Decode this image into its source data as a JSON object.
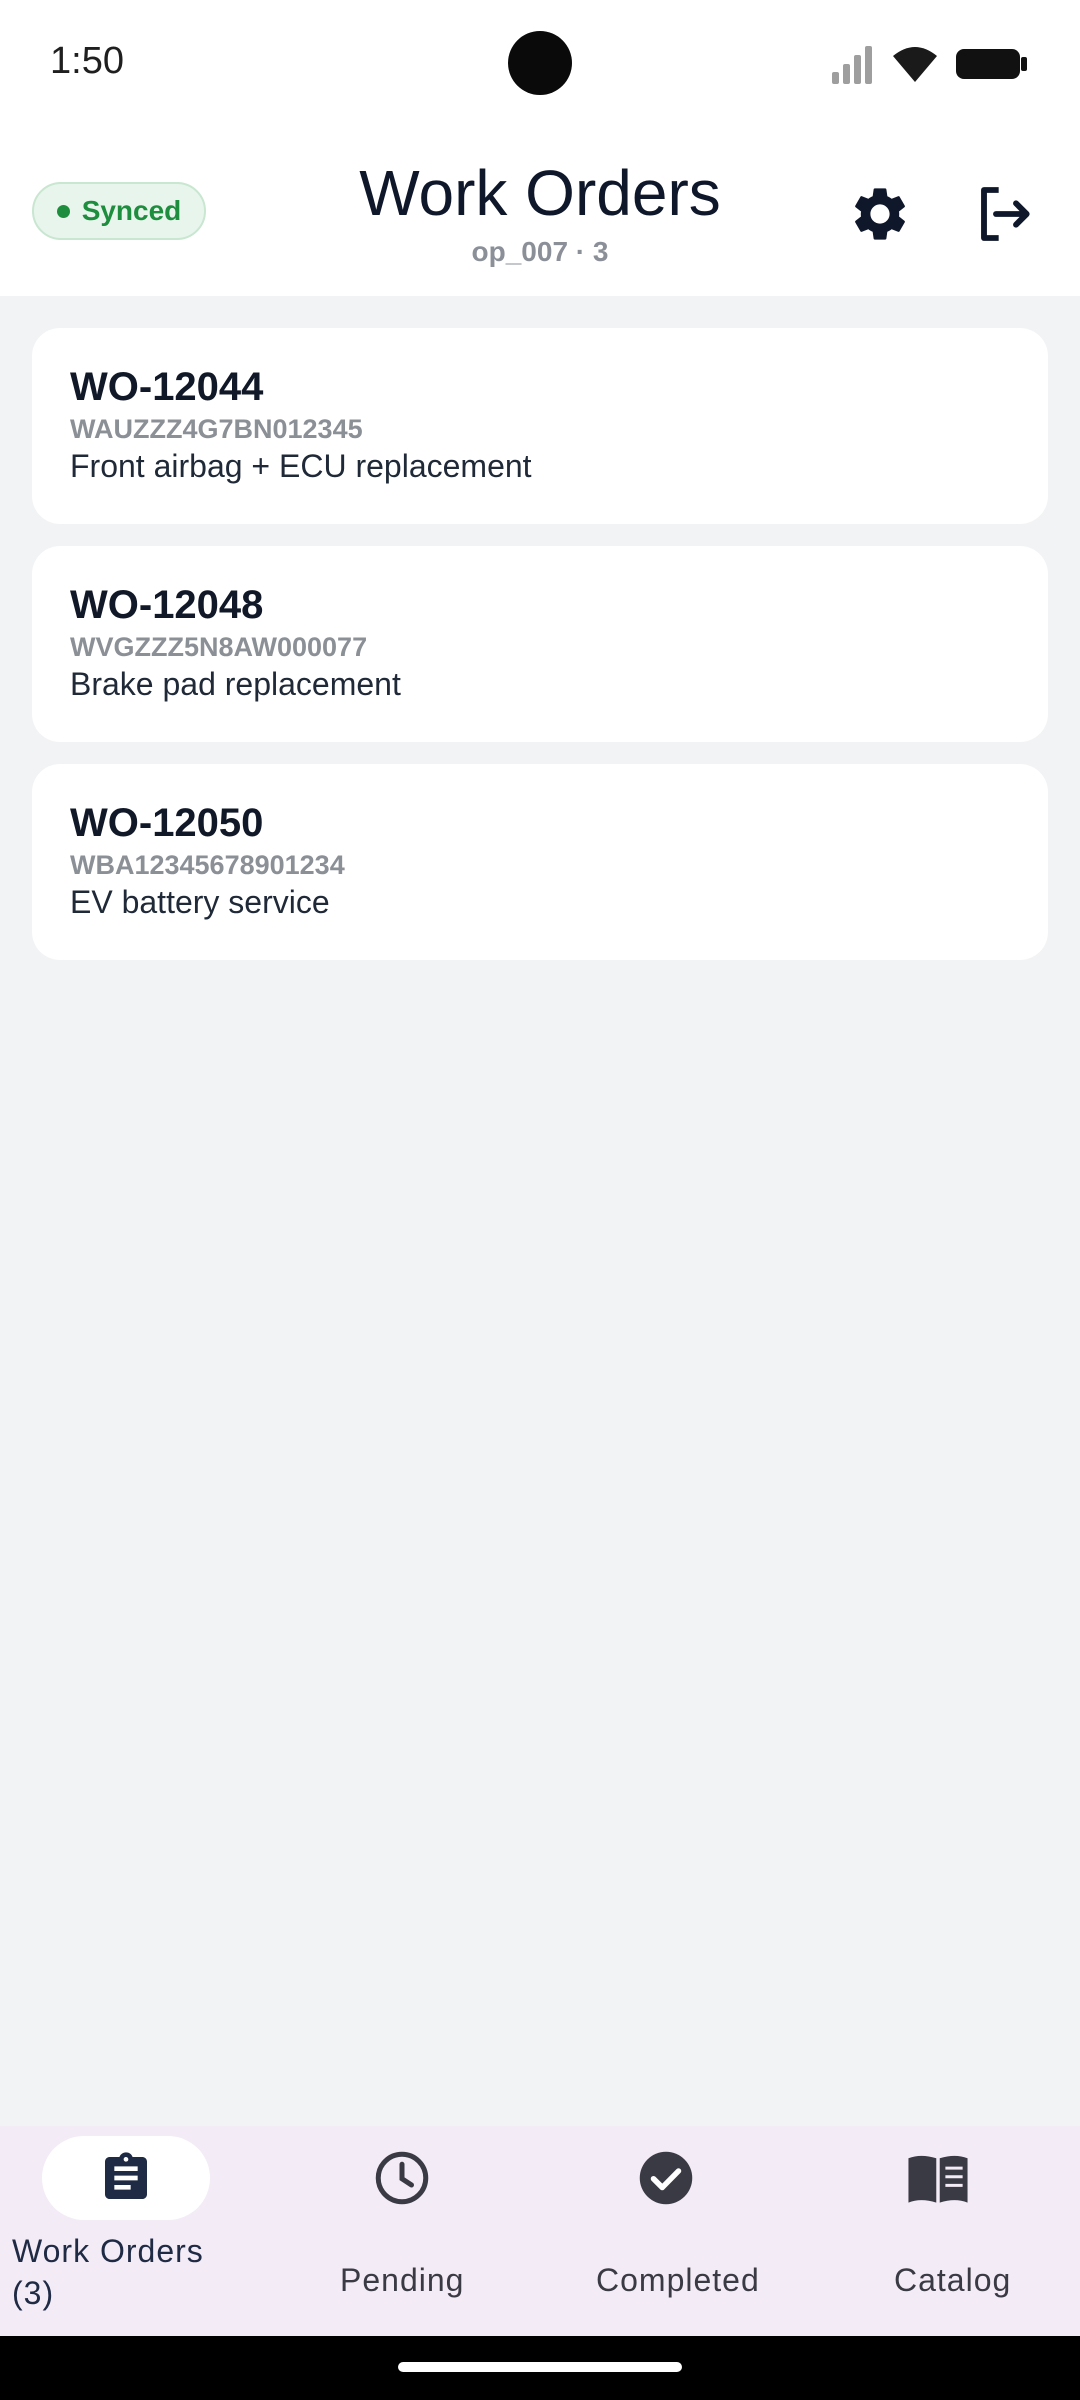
{
  "status_bar": {
    "time": "1:50"
  },
  "header": {
    "sync_status": "Synced",
    "title": "Work Orders",
    "subtitle": "op_007 · 3"
  },
  "work_orders": [
    {
      "id": "WO-12044",
      "vin": "WAUZZZ4G7BN012345",
      "description": "Front airbag + ECU replacement"
    },
    {
      "id": "WO-12048",
      "vin": "WVGZZZ5N8AW000077",
      "description": "Brake pad replacement"
    },
    {
      "id": "WO-12050",
      "vin": "WBA12345678901234",
      "description": "EV battery service"
    }
  ],
  "bottom_nav": {
    "items": [
      {
        "label": "Work Orders (3)",
        "icon": "clipboard-icon",
        "active": true
      },
      {
        "label": "Pending",
        "icon": "clock-icon",
        "active": false
      },
      {
        "label": "Completed",
        "icon": "check-circle-icon",
        "active": false
      },
      {
        "label": "Catalog",
        "icon": "book-icon",
        "active": false
      }
    ]
  },
  "colors": {
    "sync_green": "#1e8e3e",
    "nav_background": "#f3ebf6",
    "title_navy": "#0f172a"
  }
}
